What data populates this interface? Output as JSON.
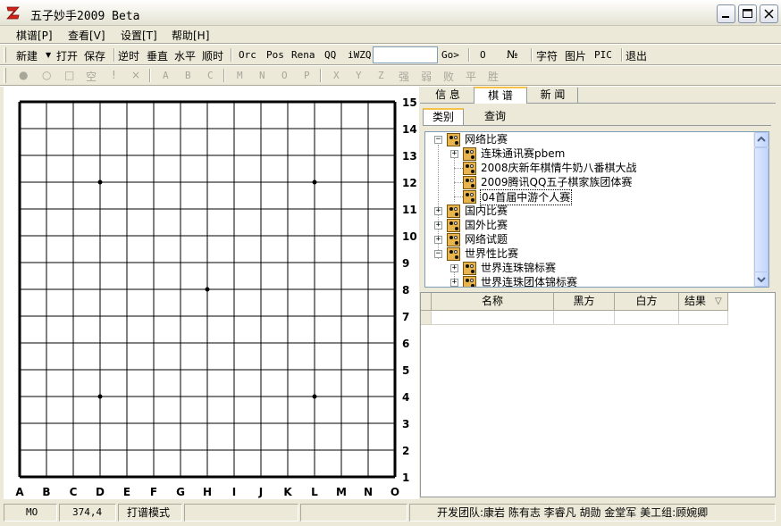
{
  "window": {
    "title": "五子妙手2009 Beta"
  },
  "menu": [
    {
      "label": "棋谱[P]"
    },
    {
      "label": "查看[V]"
    },
    {
      "label": "设置[T]"
    },
    {
      "label": "帮助[H]"
    }
  ],
  "toolbar1": {
    "new": "新建",
    "open": "打开",
    "save": "保存",
    "ccw": "逆时",
    "vertical": "垂直",
    "horizontal": "水平",
    "cw": "顺时",
    "orc": "Orc",
    "pos": "Pos",
    "rena": "Rena",
    "qq": "QQ",
    "iwzq": "iWZQ",
    "input_value": "",
    "go": "Go>",
    "circle": "O",
    "number": "№",
    "text": "字符",
    "image": "图片",
    "pic": "PIC",
    "exit": "退出"
  },
  "toolbar2": {
    "items": [
      "●",
      "○",
      "□",
      "空",
      "!",
      "×",
      "A",
      "B",
      "C",
      "M",
      "N",
      "O",
      "P",
      "X",
      "Y",
      "Z",
      "强",
      "弱",
      "败",
      "平",
      "胜"
    ]
  },
  "board": {
    "size": 15,
    "col_labels": [
      "A",
      "B",
      "C",
      "D",
      "E",
      "F",
      "G",
      "H",
      "I",
      "J",
      "K",
      "L",
      "M",
      "N",
      "O"
    ],
    "row_labels": [
      "15",
      "14",
      "13",
      "12",
      "11",
      "10",
      "9",
      "8",
      "7",
      "6",
      "5",
      "4",
      "3",
      "2",
      "1"
    ],
    "star_points": [
      "D12",
      "L12",
      "H8",
      "D4",
      "L4"
    ]
  },
  "tabs": [
    {
      "label": "信  息"
    },
    {
      "label": "棋  谱"
    },
    {
      "label": "新  闻"
    }
  ],
  "subtabs": [
    {
      "label": "类别"
    },
    {
      "label": "查询"
    }
  ],
  "tree": [
    {
      "label": "网络比赛",
      "expanded": true,
      "level": 0
    },
    {
      "label": "连珠通讯赛pbem",
      "expanded": false,
      "level": 1
    },
    {
      "label": "2008庆新年棋情牛奶八番棋大战",
      "level": 1
    },
    {
      "label": "2009腾讯QQ五子棋家族团体赛",
      "level": 1
    },
    {
      "label": "04首届中游个人赛",
      "level": 1,
      "selected": true
    },
    {
      "label": "国内比赛",
      "expanded": false,
      "level": 0
    },
    {
      "label": "国外比赛",
      "expanded": false,
      "level": 0
    },
    {
      "label": "网络试题",
      "expanded": false,
      "level": 0
    },
    {
      "label": "世界性比赛",
      "expanded": true,
      "level": 0
    },
    {
      "label": "世界连珠锦标赛",
      "expanded": false,
      "level": 1
    },
    {
      "label": "世界连珠团体锦标赛",
      "expanded": false,
      "level": 1
    }
  ],
  "table": {
    "columns": [
      "名称",
      "黑方",
      "白方",
      "结果"
    ],
    "sort_indicator": "▽"
  },
  "status": {
    "move": "MO",
    "coords": "374,4",
    "mode": "打谱模式",
    "dev_team": "开发团队:康岩  陈有志  李睿凡  胡勋  金堂军  美工组:顾婉卿"
  },
  "colors": {
    "board_line": "#000000",
    "window_bg": "#ece9d8",
    "folder": "#e8b54a"
  }
}
